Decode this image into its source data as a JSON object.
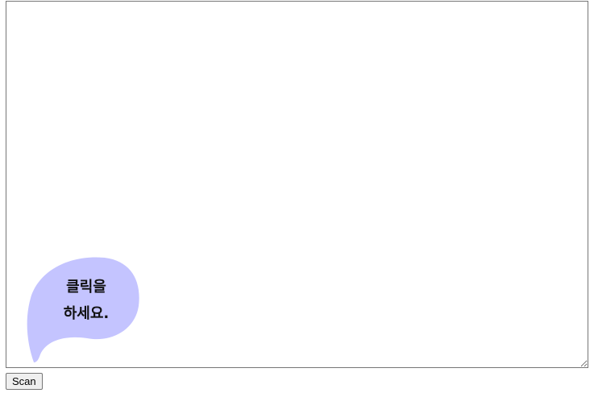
{
  "editor": {
    "value": "",
    "placeholder": ""
  },
  "bubble": {
    "line1": "클릭을",
    "line2": "하세요.",
    "fill_color": "#c4c4ff"
  },
  "scan_button": {
    "label": "Scan"
  }
}
